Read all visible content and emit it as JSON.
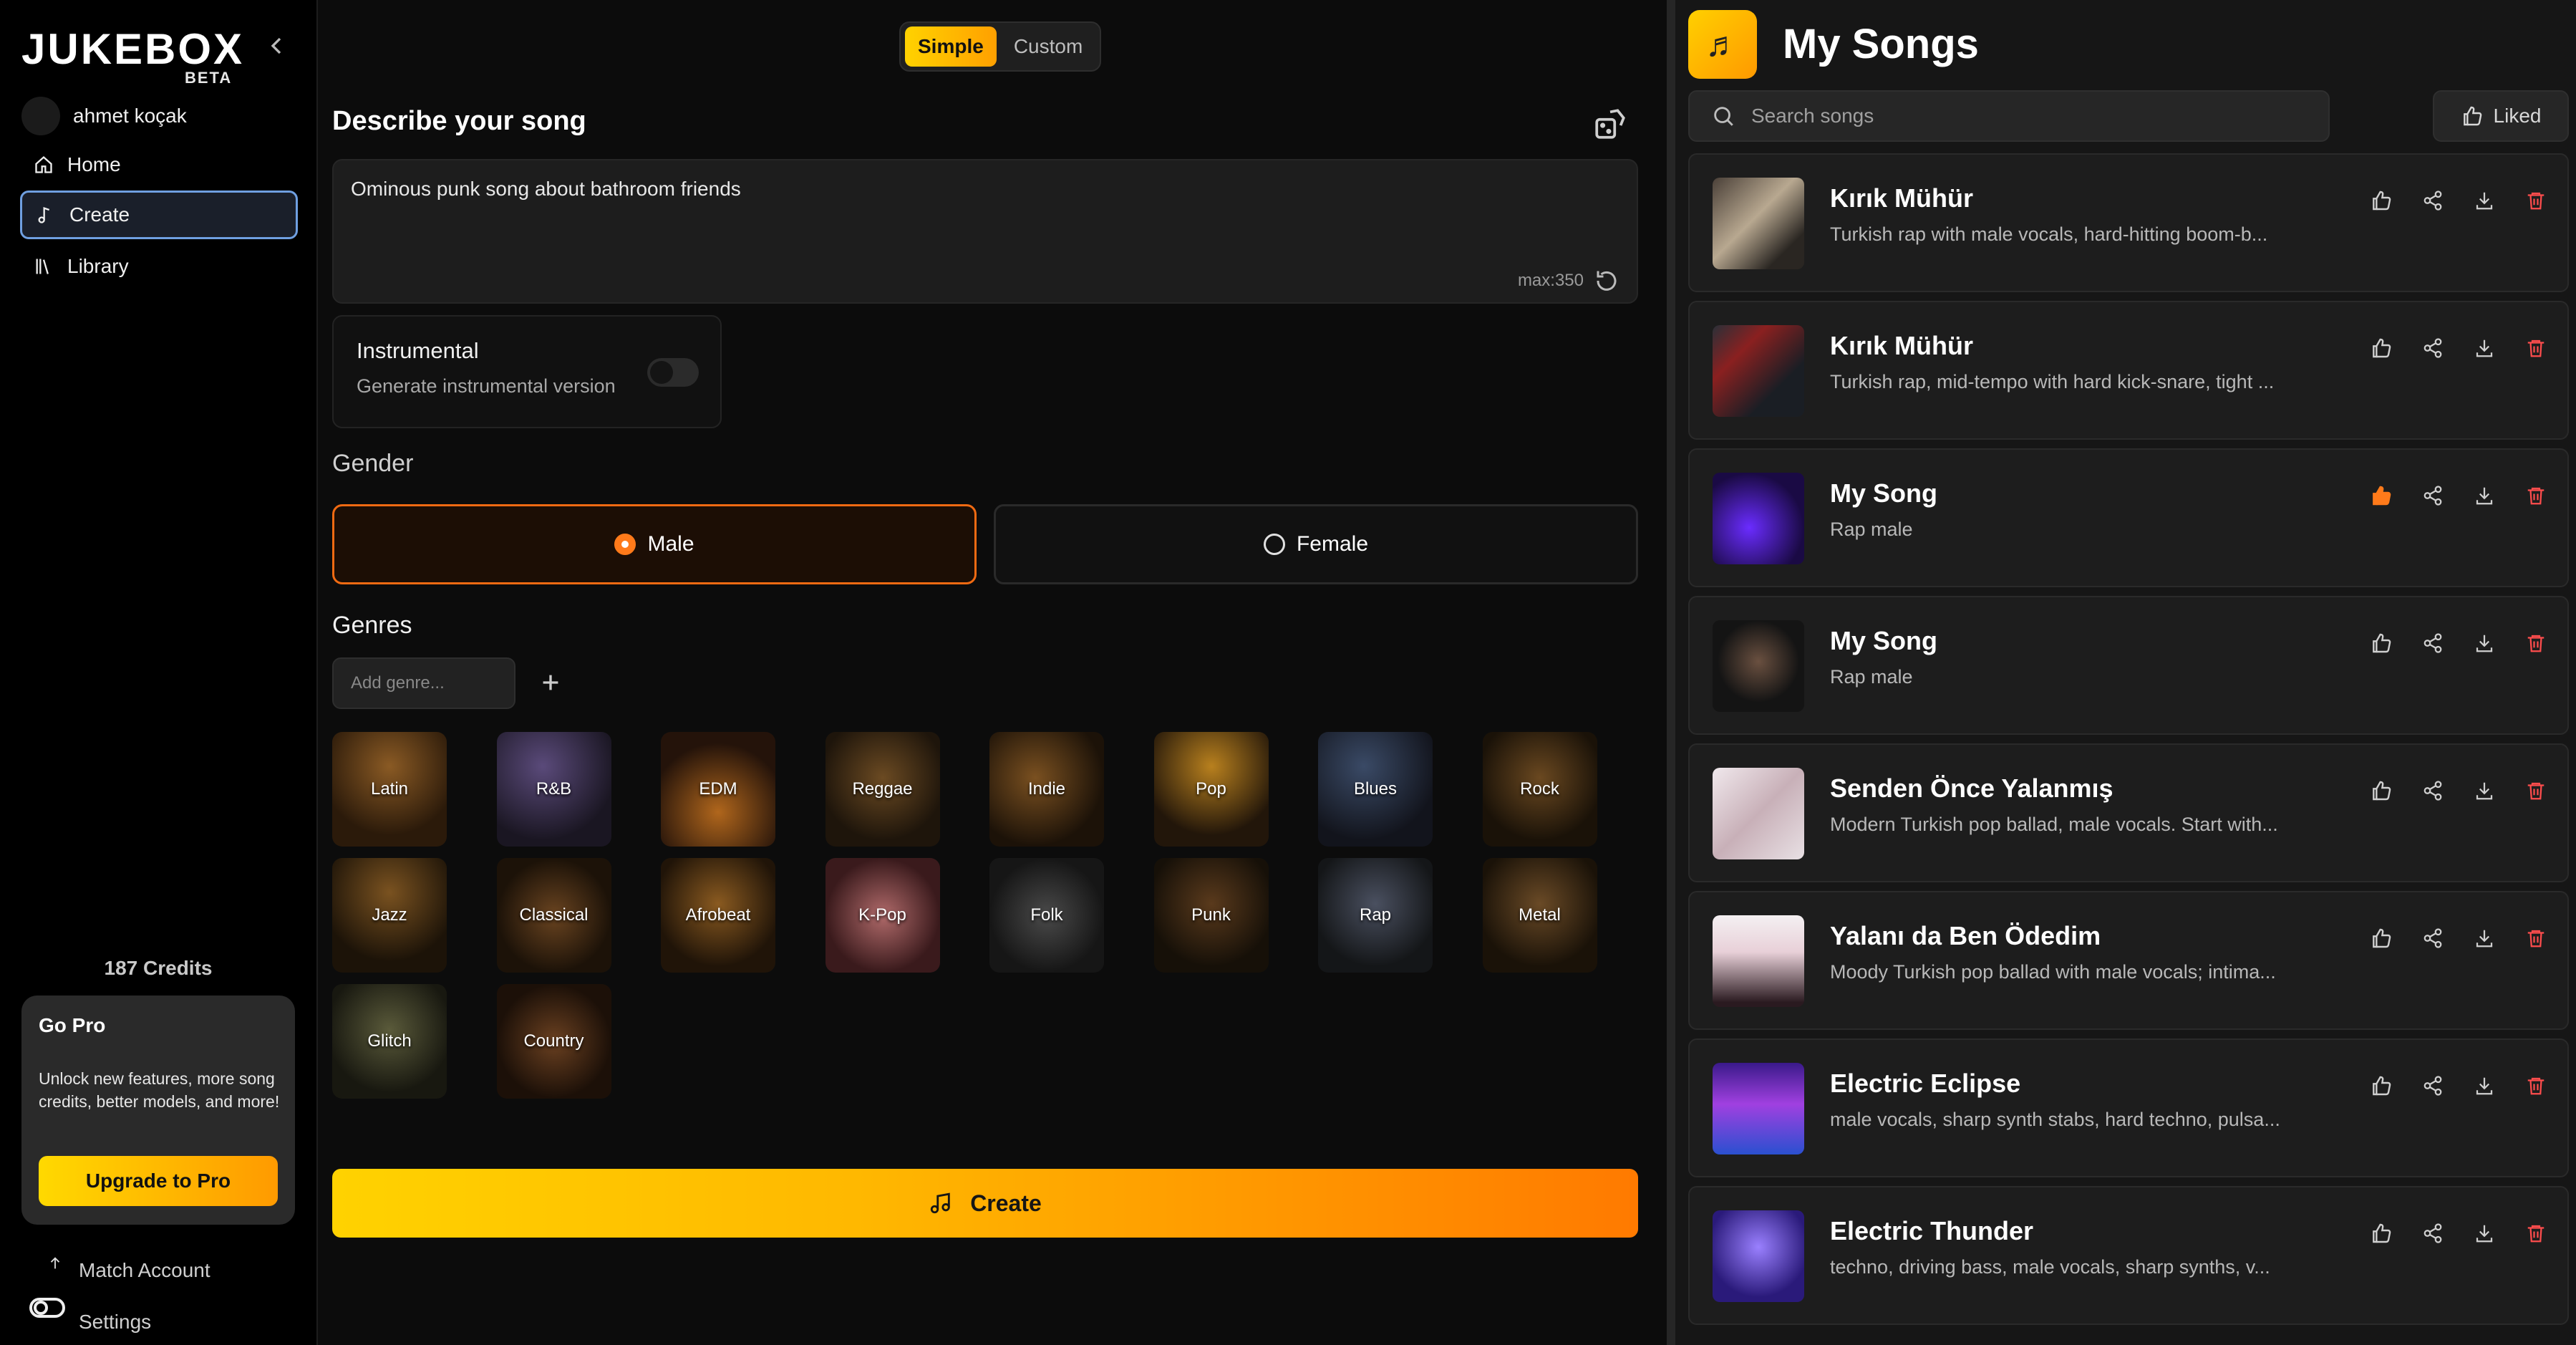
{
  "sidebar": {
    "brand": "JUKEBOX",
    "badge": "BETA",
    "user_name": "ahmet koçak",
    "nav": [
      {
        "label": "Home",
        "icon": "home-icon"
      },
      {
        "label": "Create",
        "icon": "music-note-icon"
      },
      {
        "label": "Library",
        "icon": "library-icon"
      }
    ],
    "credits": "187 Credits",
    "gopro": {
      "title": "Go Pro",
      "text": "Unlock new features, more song credits, better models, and more!",
      "button": "Upgrade to Pro"
    },
    "match_account": "Match Account",
    "settings": "Settings"
  },
  "create": {
    "modes": [
      "Simple",
      "Custom"
    ],
    "active_mode": "Simple",
    "describe_heading": "Describe your song",
    "prompt_value": "Ominous punk song about bathroom friends",
    "prompt_max": "max:350",
    "instrumental": {
      "title": "Instrumental",
      "subtitle": "Generate instrumental version",
      "enabled": false
    },
    "gender_heading": "Gender",
    "gender_options": [
      "Male",
      "Female"
    ],
    "gender_selected": "Male",
    "genres_heading": "Genres",
    "genre_placeholder": "Add genre...",
    "genres": [
      "Latin",
      "R&B",
      "EDM",
      "Reggae",
      "Indie",
      "Pop",
      "Blues",
      "Rock",
      "Jazz",
      "Classical",
      "Afrobeat",
      "K-Pop",
      "Folk",
      "Punk",
      "Rap",
      "Metal",
      "Glitch",
      "Country"
    ],
    "create_button": "Create"
  },
  "songs": {
    "title": "My Songs",
    "search_placeholder": "Search songs",
    "liked_filter": "Liked",
    "items": [
      {
        "title": "Kırık Mühür",
        "desc": "Turkish rap with male vocals, hard-hitting boom-b...",
        "liked": false
      },
      {
        "title": "Kırık Mühür",
        "desc": "Turkish rap, mid-tempo with hard kick-snare, tight ...",
        "liked": false
      },
      {
        "title": "My Song",
        "desc": "Rap male",
        "liked": true
      },
      {
        "title": "My Song",
        "desc": "Rap male",
        "liked": false
      },
      {
        "title": "Senden Önce Yalanmış",
        "desc": "Modern Turkish pop ballad, male vocals. Start with...",
        "liked": false
      },
      {
        "title": "Yalanı da Ben Ödedim",
        "desc": "Moody Turkish pop ballad with male vocals; intima...",
        "liked": false
      },
      {
        "title": "Electric Eclipse",
        "desc": "male vocals, sharp synth stabs, hard techno, pulsa...",
        "liked": false
      },
      {
        "title": "Electric Thunder",
        "desc": "techno, driving bass, male vocals, sharp synths, v...",
        "liked": false
      }
    ]
  },
  "colors": {
    "accent_yellow": "#ffd200",
    "accent_orange": "#ff7a00",
    "liked": "#ff7a1a",
    "delete": "#ff4d4d",
    "active_nav_border": "#6f9fe0"
  }
}
